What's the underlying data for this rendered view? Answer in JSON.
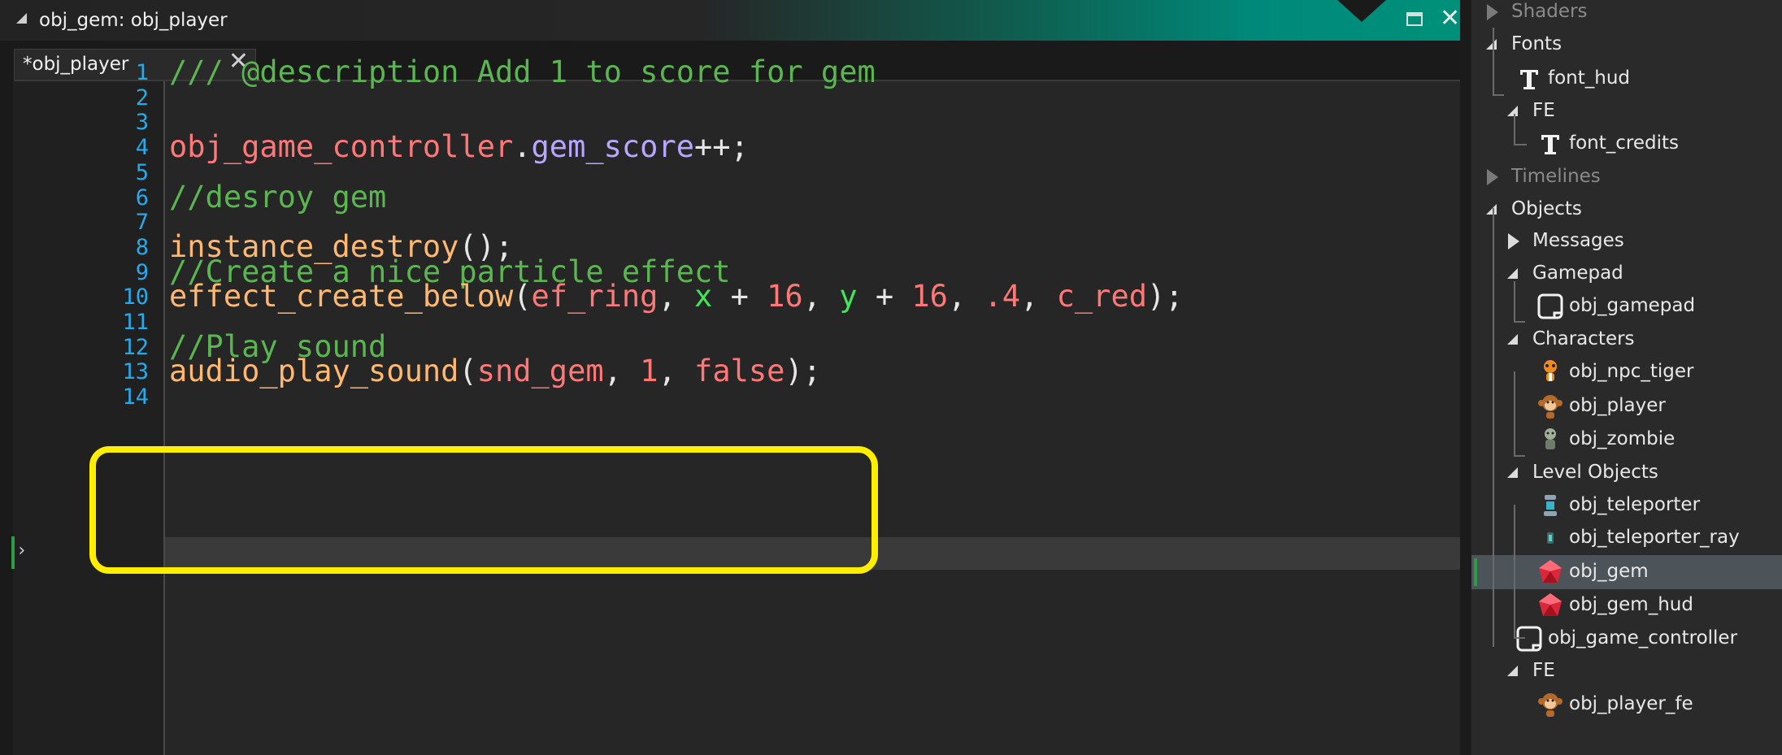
{
  "window": {
    "title": "obj_gem: obj_player"
  },
  "tab": {
    "label": "*obj_player"
  },
  "code_lines": [
    {
      "n": "1",
      "tokens": [
        {
          "t": "/// @description Add 1 to score for gem",
          "c": "c-com"
        }
      ]
    },
    {
      "n": "2",
      "tokens": []
    },
    {
      "n": "3",
      "tokens": []
    },
    {
      "n": "4",
      "tokens": [
        {
          "t": "obj_game_controller",
          "c": "c-var"
        },
        {
          "t": ".",
          "c": "c-pun"
        },
        {
          "t": "gem_score",
          "c": "c-mem"
        },
        {
          "t": "++;",
          "c": "c-pun"
        }
      ]
    },
    {
      "n": "5",
      "tokens": []
    },
    {
      "n": "6",
      "tokens": [
        {
          "t": "//desroy gem",
          "c": "c-com"
        }
      ]
    },
    {
      "n": "7",
      "tokens": []
    },
    {
      "n": "8",
      "tokens": [
        {
          "t": "instance_destroy",
          "c": "c-fn"
        },
        {
          "t": "();",
          "c": "c-pun"
        }
      ]
    },
    {
      "n": "9",
      "tokens": [
        {
          "t": "//Create a nice particle effect",
          "c": "c-com"
        }
      ]
    },
    {
      "n": "10",
      "tokens": [
        {
          "t": "effect_create_below",
          "c": "c-fn"
        },
        {
          "t": "(",
          "c": "c-pun"
        },
        {
          "t": "ef_ring",
          "c": "c-var"
        },
        {
          "t": ", ",
          "c": "c-pun"
        },
        {
          "t": "x",
          "c": "c-bi"
        },
        {
          "t": " + ",
          "c": "c-pun"
        },
        {
          "t": "16",
          "c": "c-num"
        },
        {
          "t": ", ",
          "c": "c-pun"
        },
        {
          "t": "y",
          "c": "c-bi"
        },
        {
          "t": " + ",
          "c": "c-pun"
        },
        {
          "t": "16",
          "c": "c-num"
        },
        {
          "t": ", ",
          "c": "c-pun"
        },
        {
          "t": ".4",
          "c": "c-num"
        },
        {
          "t": ", ",
          "c": "c-pun"
        },
        {
          "t": "c_red",
          "c": "c-var"
        },
        {
          "t": ");",
          "c": "c-pun"
        }
      ]
    },
    {
      "n": "11",
      "tokens": []
    },
    {
      "n": "12",
      "tokens": [
        {
          "t": "//Play sound",
          "c": "c-com"
        }
      ]
    },
    {
      "n": "13",
      "tokens": [
        {
          "t": "audio_play_sound",
          "c": "c-fn"
        },
        {
          "t": "(",
          "c": "c-pun"
        },
        {
          "t": "snd_gem",
          "c": "c-var"
        },
        {
          "t": ", ",
          "c": "c-pun"
        },
        {
          "t": "1",
          "c": "c-num"
        },
        {
          "t": ", ",
          "c": "c-pun"
        },
        {
          "t": "false",
          "c": "c-var"
        },
        {
          "t": ");",
          "c": "c-pun"
        }
      ]
    },
    {
      "n": "14",
      "tokens": []
    }
  ],
  "tree": [
    {
      "label": "Shaders",
      "level": 0,
      "kind": "group-collapsed",
      "dim": true
    },
    {
      "label": "Fonts",
      "level": 0,
      "kind": "group-open"
    },
    {
      "label": "font_hud",
      "level": 1,
      "kind": "font"
    },
    {
      "label": "FE",
      "level": 1,
      "kind": "group-open"
    },
    {
      "label": "font_credits",
      "level": 2,
      "kind": "font"
    },
    {
      "label": "Timelines",
      "level": 0,
      "kind": "group-collapsed",
      "dim": true
    },
    {
      "label": "Objects",
      "level": 0,
      "kind": "group-open"
    },
    {
      "label": "Messages",
      "level": 1,
      "kind": "group-collapsed"
    },
    {
      "label": "Gamepad",
      "level": 1,
      "kind": "group-open"
    },
    {
      "label": "obj_gamepad",
      "level": 2,
      "kind": "object-blank"
    },
    {
      "label": "Characters",
      "level": 1,
      "kind": "group-open"
    },
    {
      "label": "obj_npc_tiger",
      "level": 2,
      "kind": "object-tiger"
    },
    {
      "label": "obj_player",
      "level": 2,
      "kind": "object-monkey"
    },
    {
      "label": "obj_zombie",
      "level": 2,
      "kind": "object-zombie"
    },
    {
      "label": "Level Objects",
      "level": 1,
      "kind": "group-open"
    },
    {
      "label": "obj_teleporter",
      "level": 2,
      "kind": "object-teleporter"
    },
    {
      "label": "obj_teleporter_ray",
      "level": 2,
      "kind": "object-ray"
    },
    {
      "label": "obj_gem",
      "level": 2,
      "kind": "object-gem",
      "selected": true
    },
    {
      "label": "obj_gem_hud",
      "level": 2,
      "kind": "object-gem"
    },
    {
      "label": "obj_game_controller",
      "level": 1,
      "kind": "object-blank"
    },
    {
      "label": "FE",
      "level": 1,
      "kind": "group-open"
    },
    {
      "label": "obj_player_fe",
      "level": 2,
      "kind": "object-monkey"
    }
  ]
}
